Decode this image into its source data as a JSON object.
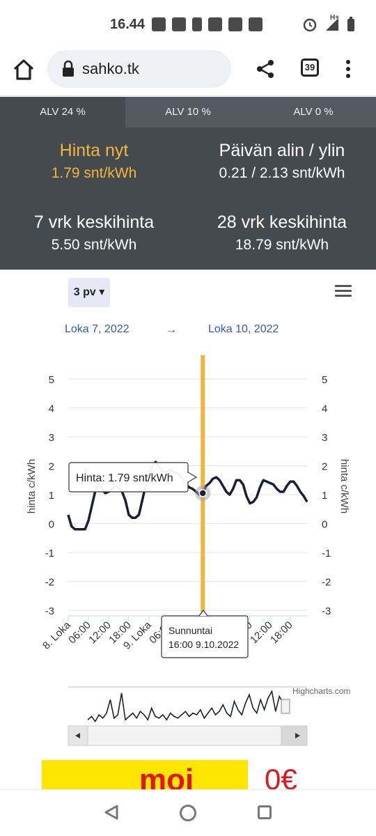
{
  "status_bar": {
    "time": "16.44",
    "network": "H+"
  },
  "browser": {
    "url": "sahko.tk",
    "tab_count": "39"
  },
  "vat_tabs": [
    {
      "label": "ALV 24 %",
      "active": true
    },
    {
      "label": "ALV 10 %",
      "active": false
    },
    {
      "label": "ALV 0 %",
      "active": false
    }
  ],
  "stats": {
    "now_label": "Hinta nyt",
    "now_value": "1.79 snt/kWh",
    "day_label": "Päivän alin / ylin",
    "day_value": "0.21 / 2.13 snt/kWh",
    "week_label": "7 vrk keskihinta",
    "week_value": "5.50 snt/kWh",
    "month_label": "28 vrk keskihinta",
    "month_value": "18.79 snt/kWh"
  },
  "controls": {
    "range_label": "3 pv ▾",
    "date_from": "Loka 7, 2022",
    "date_arrow": "→",
    "date_to": "Loka 10, 2022"
  },
  "tooltip": {
    "price": "Hinta: 1.79 snt/kWh",
    "day": "Sunnuntai",
    "time": "16:00 9.10.2022"
  },
  "credit": "Highcharts.com",
  "ad": {
    "text": "moi",
    "price": "0€"
  },
  "colors": {
    "panel": "#454a4f",
    "accent": "#f2b53c",
    "line": "#1c1f33",
    "link": "#335ba6"
  },
  "chart_data": {
    "type": "line",
    "ylabel": "hinta c/kWh",
    "ylim": [
      -3,
      5
    ],
    "yticks": [
      "5",
      "4",
      "3",
      "2",
      "1",
      "0",
      "-1",
      "-2",
      "-3"
    ],
    "xticks": [
      "8. Loka",
      "06:00",
      "12:00",
      "18:00",
      "9. Loka",
      "06:00",
      "12:00",
      "18:00",
      "10. Loka",
      "06:00",
      "12:00",
      "18:00"
    ],
    "series": [
      {
        "hours": [
          0,
          1,
          2,
          3,
          4,
          5,
          6,
          7,
          8,
          9,
          10,
          11,
          12,
          13,
          14,
          15,
          16,
          17,
          18,
          19,
          20,
          21,
          22,
          23,
          24,
          25,
          26,
          27,
          28,
          29,
          30,
          31,
          32,
          33,
          34,
          35,
          36,
          37,
          38,
          39,
          40,
          41,
          42,
          43,
          44,
          45,
          46,
          47,
          48,
          49,
          50,
          51,
          52,
          53,
          54,
          55,
          56,
          57,
          58,
          59,
          60,
          61,
          62,
          63,
          64,
          65,
          66,
          67,
          68,
          69,
          70,
          71
        ],
        "values": [
          0.3,
          -0.1,
          -0.2,
          -0.2,
          -0.2,
          -0.2,
          0.1,
          0.6,
          1.1,
          1.35,
          1.2,
          1.05,
          1.1,
          1.2,
          1.3,
          1.25,
          1.1,
          0.8,
          0.3,
          0.2,
          0.2,
          0.3,
          0.8,
          1.3,
          1.7,
          2.0,
          2.13,
          1.95,
          1.8,
          1.79,
          1.85,
          1.8,
          1.75,
          1.7,
          1.55,
          1.35,
          1.25,
          1.2,
          1.1,
          1.0,
          1.05,
          1.3,
          1.4,
          1.55,
          1.6,
          1.5,
          1.3,
          1.1,
          1.0,
          1.2,
          1.5,
          1.5,
          1.35,
          0.95,
          0.7,
          0.75,
          0.9,
          1.25,
          1.5,
          1.45,
          1.4,
          1.35,
          1.2,
          1.1,
          1.1,
          1.3,
          1.45,
          1.45,
          1.3,
          1.1,
          0.95,
          0.75
        ]
      }
    ],
    "highlight_hour": 40,
    "navigator_values": [
      0.2,
      0.4,
      0.1,
      0.5,
      0.3,
      0.6,
      1.4,
      0.3,
      0.5,
      1.8,
      0.2,
      0.4,
      0.6,
      0.3,
      0.7,
      0.5,
      0.2,
      0.9,
      0.4,
      0.3,
      0.5,
      0.2,
      0.6,
      0.4,
      0.3,
      0.5,
      0.7,
      0.4,
      0.6,
      0.5,
      0.8,
      0.3,
      0.6,
      0.9,
      0.5,
      0.7,
      1.1,
      0.6,
      0.4,
      1.3,
      0.8,
      0.5,
      1.2,
      1.7,
      0.9,
      0.6,
      1.4,
      0.8,
      1.5,
      1.9,
      0.7,
      1.6,
      1.2,
      0.8
    ]
  }
}
